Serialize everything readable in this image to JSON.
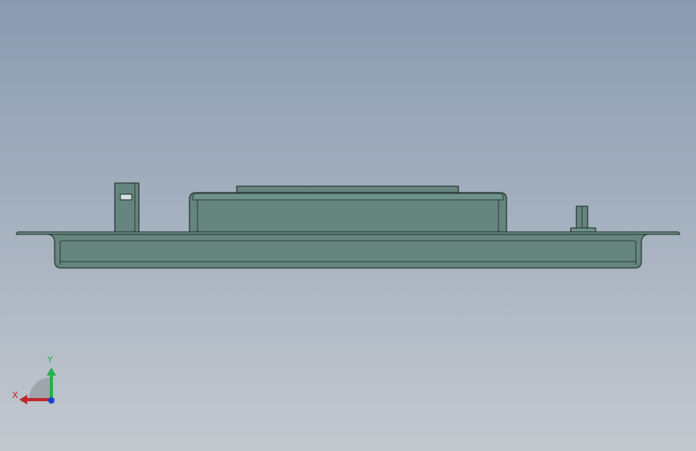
{
  "viewport": {
    "background_top": "#8a9bb0",
    "background_bottom": "#c3c8cf"
  },
  "model": {
    "view": "front",
    "body_color": "#65857e",
    "body_color_light": "#6f928a",
    "edge_color": "#1c2a27"
  },
  "triad": {
    "x_label": "X",
    "y_label": "Y",
    "x_color": "#c0282d",
    "y_color": "#22b14c",
    "z_color": "#1f3fd1"
  }
}
